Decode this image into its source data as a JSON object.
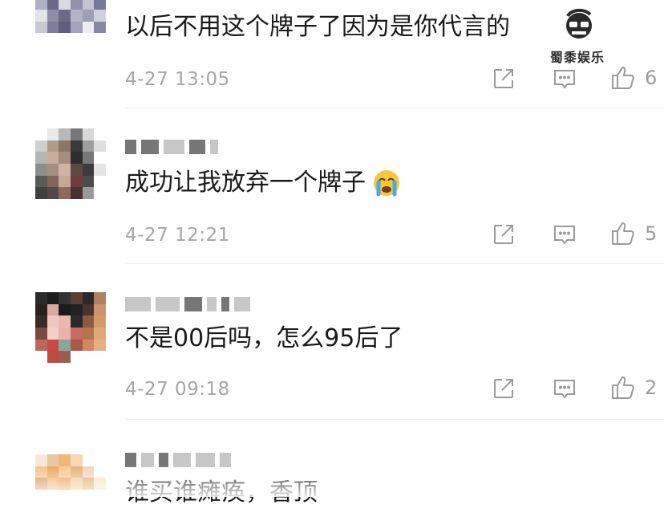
{
  "comments": [
    {
      "text": "以后不用这个牌子了因为是你代言的",
      "time": "4-27 13:05",
      "likes": "6"
    },
    {
      "text": "成功让我放弃一个牌子",
      "time": "4-27 12:21",
      "likes": "5"
    },
    {
      "text": "不是00后吗，怎么95后了",
      "time": "4-27 09:18",
      "likes": "2"
    },
    {
      "text": "谁买谁瘫痪，香顶"
    }
  ],
  "icons": {
    "share": "share-icon",
    "comment": "comment-icon",
    "like": "thumbs-up-icon",
    "emoji": "crying-face-emoji"
  },
  "watermark": {
    "label": "蜀黍娱乐"
  },
  "colors": {
    "text": "#1a1a1a",
    "meta": "#a6a6a6",
    "icon": "#9a9a9a"
  }
}
